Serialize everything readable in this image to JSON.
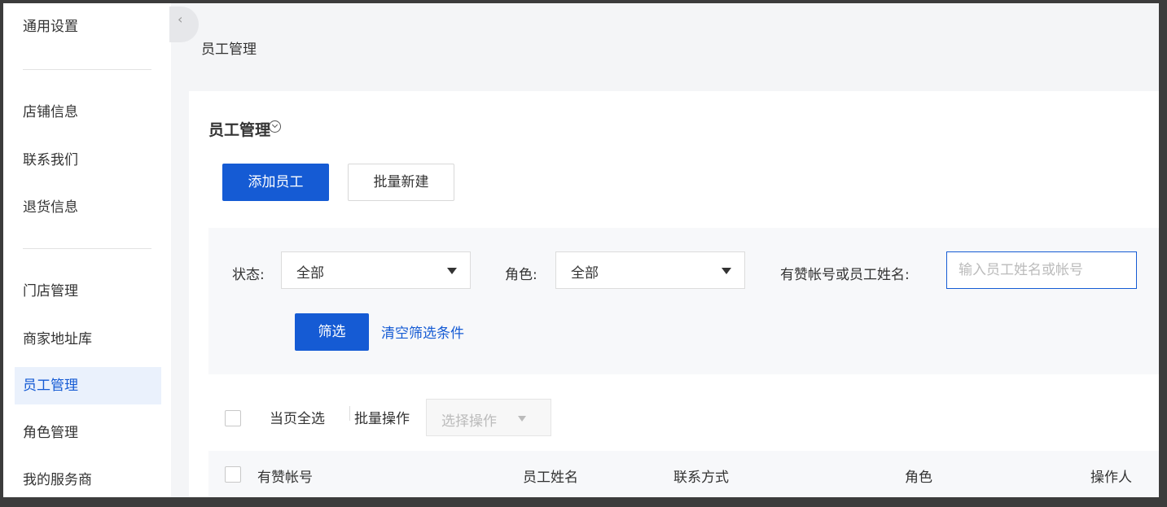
{
  "sidebar": {
    "items": [
      {
        "label": "通用设置"
      },
      {
        "label": "店铺信息"
      },
      {
        "label": "联系我们"
      },
      {
        "label": "退货信息"
      },
      {
        "label": "门店管理"
      },
      {
        "label": "商家地址库"
      },
      {
        "label": "员工管理",
        "active": true
      },
      {
        "label": "角色管理"
      },
      {
        "label": "我的服务商"
      }
    ]
  },
  "breadcrumb": "员工管理",
  "panel": {
    "title": "员工管理",
    "add_button": "添加员工",
    "batch_create_button": "批量新建"
  },
  "filters": {
    "status_label": "状态:",
    "status_value": "全部",
    "role_label": "角色:",
    "role_value": "全部",
    "account_label": "有赞帐号或员工姓名:",
    "account_placeholder": "输入员工姓名或帐号",
    "filter_button": "筛选",
    "clear_link": "清空筛选条件"
  },
  "batch": {
    "select_all": "当页全选",
    "batch_ops": "批量操作",
    "select_op": "选择操作"
  },
  "table": {
    "columns": [
      "有赞帐号",
      "员工姓名",
      "联系方式",
      "角色",
      "操作人"
    ]
  },
  "colors": {
    "accent": "#155bd4",
    "active_bg": "#eaf1fc",
    "page_bg": "#f4f5f7"
  }
}
